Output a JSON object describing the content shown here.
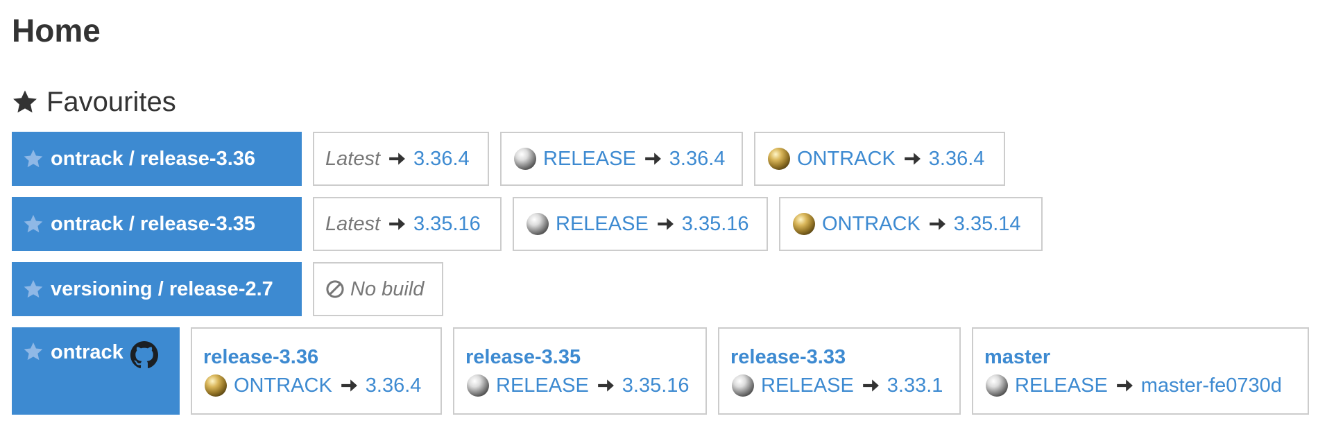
{
  "page": {
    "title": "Home"
  },
  "favourites": {
    "title": "Favourites",
    "rows": [
      {
        "project": "ontrack",
        "branch": "release-3.36",
        "items": [
          {
            "kind": "latest",
            "label": "Latest",
            "value": "3.36.4"
          },
          {
            "kind": "promotion",
            "medal": "silver-medal-icon",
            "label": "RELEASE",
            "value": "3.36.4"
          },
          {
            "kind": "promotion",
            "medal": "gold-medal-icon",
            "label": "ONTRACK",
            "value": "3.36.4"
          }
        ]
      },
      {
        "project": "ontrack",
        "branch": "release-3.35",
        "items": [
          {
            "kind": "latest",
            "label": "Latest",
            "value": "3.35.16"
          },
          {
            "kind": "promotion",
            "medal": "silver-medal-icon",
            "label": "RELEASE",
            "value": "3.35.16"
          },
          {
            "kind": "promotion",
            "medal": "gold-medal-icon",
            "label": "ONTRACK",
            "value": "3.35.14"
          }
        ]
      },
      {
        "project": "versioning",
        "branch": "release-2.7",
        "no_build": "No build"
      }
    ],
    "project_row": {
      "project": "ontrack",
      "icon": "github-icon",
      "branches": [
        {
          "name": "release-3.36",
          "medal": "gold-medal-icon",
          "label": "ONTRACK",
          "value": "3.36.4"
        },
        {
          "name": "release-3.35",
          "medal": "silver-medal-icon",
          "label": "RELEASE",
          "value": "3.35.16"
        },
        {
          "name": "release-3.33",
          "medal": "silver-medal-icon",
          "label": "RELEASE",
          "value": "3.33.1"
        },
        {
          "name": "master",
          "medal": "silver-medal-icon",
          "label": "RELEASE",
          "value": "master-fe0730d"
        }
      ]
    }
  },
  "colors": {
    "accent": "#3d8ad1",
    "text": "#333333",
    "muted": "#777777",
    "border": "#cccccc"
  }
}
